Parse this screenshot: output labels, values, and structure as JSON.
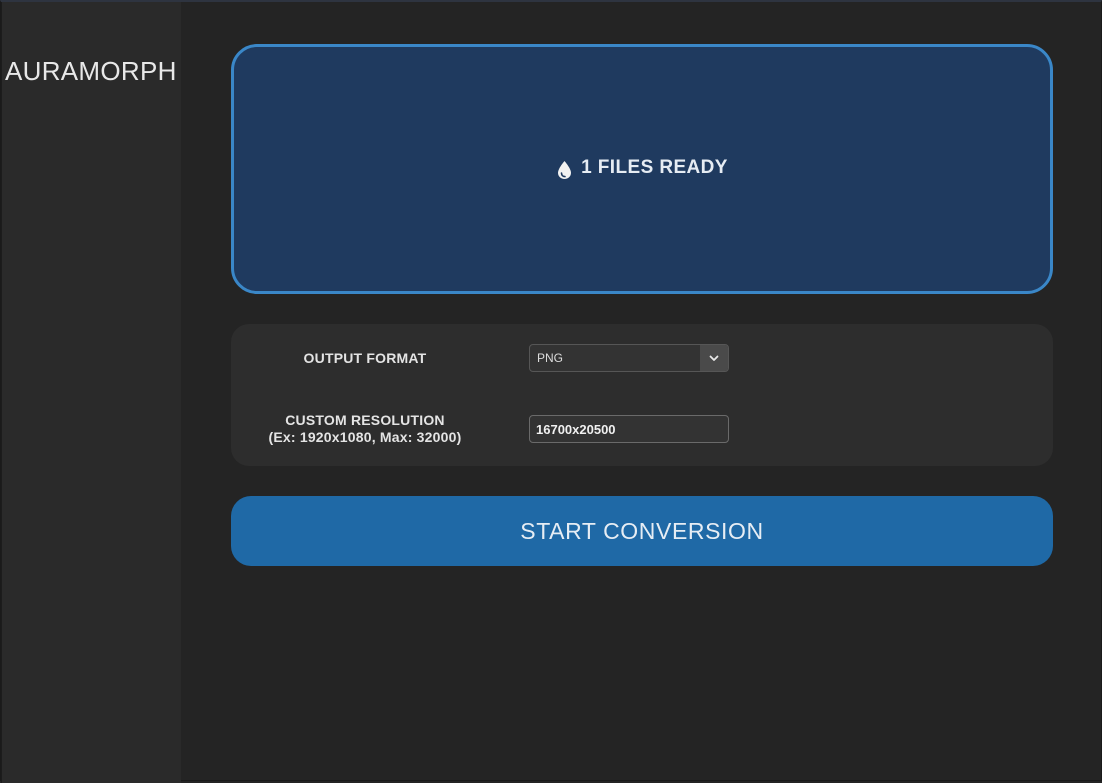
{
  "app": {
    "title": "AURAMORPH"
  },
  "drop_zone": {
    "icon": "droplet-icon",
    "status_text": "1 FILES READY"
  },
  "settings": {
    "output_format": {
      "label": "OUTPUT FORMAT",
      "selected": "PNG",
      "arrow_icon": "chevron-down-icon"
    },
    "custom_resolution": {
      "label_line1": "CUSTOM RESOLUTION",
      "label_line2": "(Ex: 1920x1080, Max: 32000)",
      "value": "16700x20500"
    }
  },
  "actions": {
    "start_label": "START CONVERSION"
  },
  "colors": {
    "background": "#242424",
    "sidebar": "#2a2a2a",
    "drop_zone_fill": "#1f3a5f",
    "drop_zone_border": "#3a87c8",
    "card": "#2d2d2d",
    "primary_button": "#1f69a6"
  }
}
